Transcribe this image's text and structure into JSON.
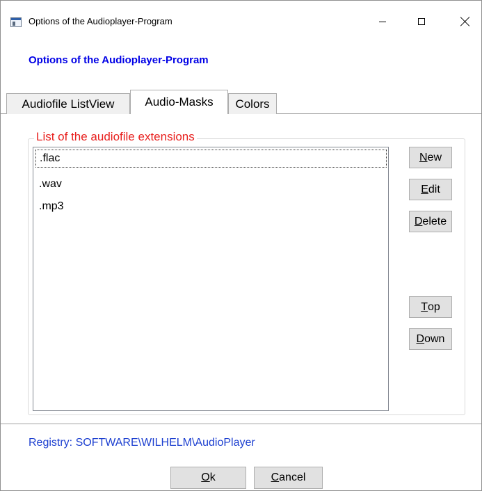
{
  "window": {
    "title": "Options of the Audioplayer-Program",
    "header": "Options of the Audioplayer-Program"
  },
  "tabs": [
    {
      "label": "Audiofile ListView",
      "selected": false
    },
    {
      "label": "Audio-Masks",
      "selected": true
    },
    {
      "label": "Colors",
      "selected": false
    }
  ],
  "group": {
    "legend": "List of the audiofile extensions"
  },
  "extensions": [
    {
      "text": ".flac",
      "focused": true
    },
    {
      "text": ".wav",
      "focused": false
    },
    {
      "text": ".mp3",
      "focused": false
    }
  ],
  "buttons": {
    "new": {
      "mnemonic": "N",
      "rest": "ew"
    },
    "edit": {
      "mnemonic": "E",
      "rest": "dit"
    },
    "delete": {
      "mnemonic": "D",
      "rest": "elete"
    },
    "top": {
      "mnemonic": "T",
      "rest": "op"
    },
    "down": {
      "mnemonic": "D",
      "rest": "own"
    },
    "ok": {
      "mnemonic": "O",
      "rest": "k"
    },
    "cancel": {
      "mnemonic": "C",
      "rest": "ancel"
    }
  },
  "registry": "Registry: SOFTWARE\\WILHELM\\AudioPlayer",
  "colors": {
    "header": "#0000e6",
    "legend": "#e8201e",
    "registry": "#1c3fd0"
  },
  "icons": {
    "app": "app-window-icon",
    "minimize": "minimize-icon",
    "maximize": "maximize-icon",
    "close": "close-icon"
  }
}
